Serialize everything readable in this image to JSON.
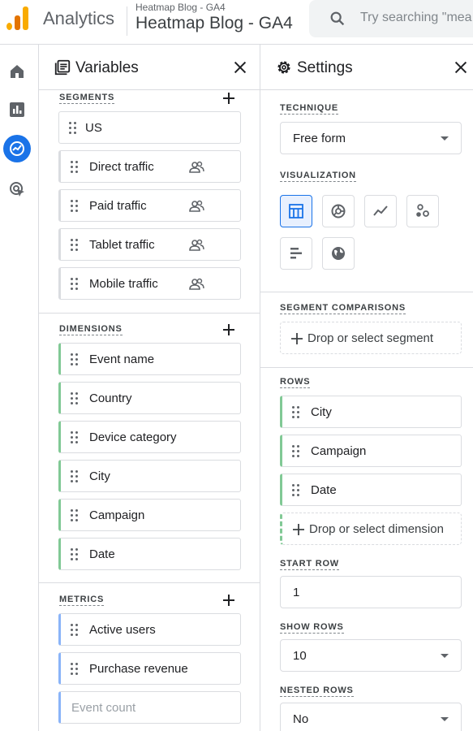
{
  "header": {
    "app_name": "Analytics",
    "property_small": "Heatmap Blog - GA4",
    "property_big": "Heatmap Blog - GA4",
    "search_placeholder": "Try searching \"mea"
  },
  "colors": {
    "accent": "#1a73e8",
    "dimension": "#81c995",
    "metric": "#8ab4f8",
    "segment": "#dadce0"
  },
  "leftnav": {
    "items": [
      "home-icon",
      "reports-icon",
      "explore-icon",
      "advertising-icon"
    ],
    "active": "explore-icon"
  },
  "variables": {
    "title": "Variables",
    "segments_label": "SEGMENTS",
    "segments": [
      "US",
      "Direct traffic",
      "Paid traffic",
      "Tablet traffic",
      "Mobile traffic"
    ],
    "dimensions_label": "DIMENSIONS",
    "dimensions": [
      "Event name",
      "Country",
      "Device category",
      "City",
      "Campaign",
      "Date"
    ],
    "metrics_label": "METRICS",
    "metrics": [
      "Active users",
      "Purchase revenue"
    ],
    "metric_placeholder": "Event count"
  },
  "settings": {
    "title": "Settings",
    "technique_label": "TECHNIQUE",
    "technique_value": "Free form",
    "visualization_label": "VISUALIZATION",
    "visualization_types": [
      "table-icon",
      "donut-chart-icon",
      "line-chart-icon",
      "scatter-plot-icon",
      "bar-chart-icon",
      "geo-map-icon"
    ],
    "segment_comparisons_label": "SEGMENT COMPARISONS",
    "segment_drop_label": "Drop or select segment",
    "rows_label": "ROWS",
    "rows": [
      "City",
      "Campaign",
      "Date"
    ],
    "rows_drop_label": "Drop or select dimension",
    "start_row_label": "START ROW",
    "start_row_value": "1",
    "show_rows_label": "SHOW ROWS",
    "show_rows_value": "10",
    "nested_rows_label": "NESTED ROWS",
    "nested_rows_value": "No"
  }
}
